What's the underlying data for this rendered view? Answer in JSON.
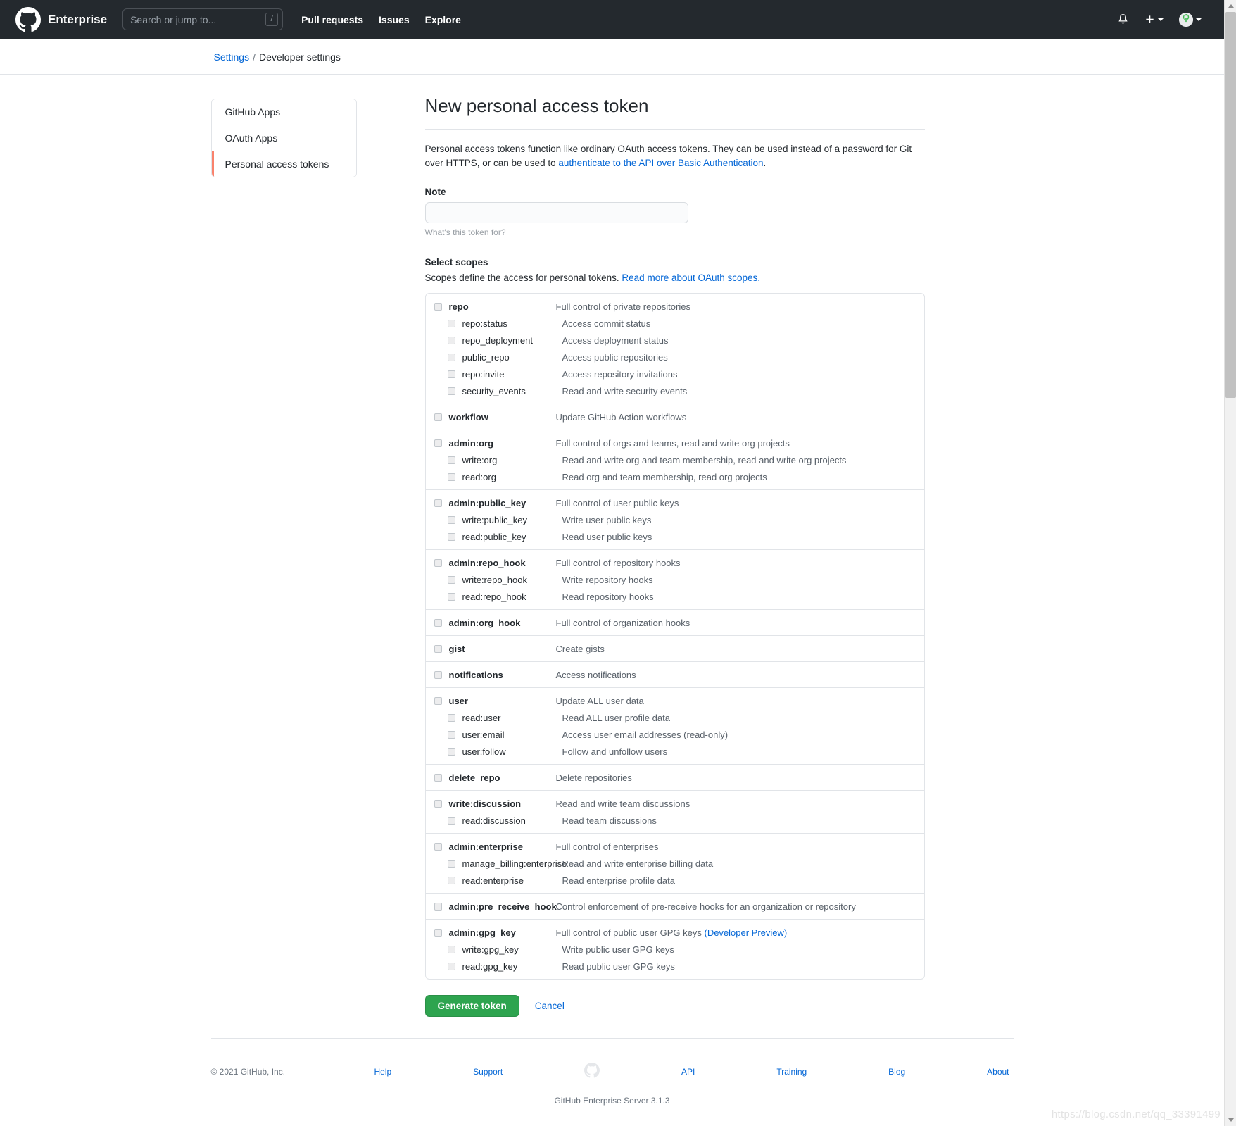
{
  "header": {
    "brand": "Enterprise",
    "search_placeholder": "Search or jump to...",
    "search_value": "",
    "slash_key": "/",
    "nav": [
      {
        "label": "Pull requests"
      },
      {
        "label": "Issues"
      },
      {
        "label": "Explore"
      }
    ],
    "icons": {
      "bell": "bell-icon",
      "plus": "plus-icon",
      "avatar": "avatar"
    }
  },
  "breadcrumb": {
    "root": "Settings",
    "separator": "/",
    "current": "Developer settings"
  },
  "sidebar": {
    "items": [
      {
        "label": "GitHub Apps",
        "active": false
      },
      {
        "label": "OAuth Apps",
        "active": false
      },
      {
        "label": "Personal access tokens",
        "active": true
      }
    ],
    "active_accent": "#f9826c"
  },
  "main": {
    "title": "New personal access token",
    "intro_part1": "Personal access tokens function like ordinary OAuth access tokens. They can be used instead of a password for Git over HTTPS, or can be used to ",
    "intro_link": "authenticate to the API over Basic Authentication",
    "intro_part2": ".",
    "note_label": "Note",
    "note_value": "",
    "note_placeholder": "",
    "note_hint": "What's this token for?",
    "scopes_label": "Select scopes",
    "scopes_sub_part1": "Scopes define the access for personal tokens. ",
    "scopes_sub_link": "Read more about OAuth scopes.",
    "generate_label": "Generate token",
    "cancel_label": "Cancel",
    "primary_color": "#2ea44f"
  },
  "scopes": [
    {
      "name": "repo",
      "desc": "Full control of private repositories",
      "checked": false,
      "children": [
        {
          "name": "repo:status",
          "desc": "Access commit status",
          "checked": false
        },
        {
          "name": "repo_deployment",
          "desc": "Access deployment status",
          "checked": false
        },
        {
          "name": "public_repo",
          "desc": "Access public repositories",
          "checked": false
        },
        {
          "name": "repo:invite",
          "desc": "Access repository invitations",
          "checked": false
        },
        {
          "name": "security_events",
          "desc": "Read and write security events",
          "checked": false
        }
      ]
    },
    {
      "name": "workflow",
      "desc": "Update GitHub Action workflows",
      "checked": false,
      "children": []
    },
    {
      "name": "admin:org",
      "desc": "Full control of orgs and teams, read and write org projects",
      "checked": false,
      "children": [
        {
          "name": "write:org",
          "desc": "Read and write org and team membership, read and write org projects",
          "checked": false
        },
        {
          "name": "read:org",
          "desc": "Read org and team membership, read org projects",
          "checked": false
        }
      ]
    },
    {
      "name": "admin:public_key",
      "desc": "Full control of user public keys",
      "checked": false,
      "children": [
        {
          "name": "write:public_key",
          "desc": "Write user public keys",
          "checked": false
        },
        {
          "name": "read:public_key",
          "desc": "Read user public keys",
          "checked": false
        }
      ]
    },
    {
      "name": "admin:repo_hook",
      "desc": "Full control of repository hooks",
      "checked": false,
      "children": [
        {
          "name": "write:repo_hook",
          "desc": "Write repository hooks",
          "checked": false
        },
        {
          "name": "read:repo_hook",
          "desc": "Read repository hooks",
          "checked": false
        }
      ]
    },
    {
      "name": "admin:org_hook",
      "desc": "Full control of organization hooks",
      "checked": false,
      "children": []
    },
    {
      "name": "gist",
      "desc": "Create gists",
      "checked": false,
      "children": []
    },
    {
      "name": "notifications",
      "desc": "Access notifications",
      "checked": false,
      "children": []
    },
    {
      "name": "user",
      "desc": "Update ALL user data",
      "checked": false,
      "children": [
        {
          "name": "read:user",
          "desc": "Read ALL user profile data",
          "checked": false
        },
        {
          "name": "user:email",
          "desc": "Access user email addresses (read-only)",
          "checked": false
        },
        {
          "name": "user:follow",
          "desc": "Follow and unfollow users",
          "checked": false
        }
      ]
    },
    {
      "name": "delete_repo",
      "desc": "Delete repositories",
      "checked": false,
      "children": []
    },
    {
      "name": "write:discussion",
      "desc": "Read and write team discussions",
      "checked": false,
      "children": [
        {
          "name": "read:discussion",
          "desc": "Read team discussions",
          "checked": false
        }
      ]
    },
    {
      "name": "admin:enterprise",
      "desc": "Full control of enterprises",
      "checked": false,
      "children": [
        {
          "name": "manage_billing:enterprise",
          "desc": "Read and write enterprise billing data",
          "checked": false
        },
        {
          "name": "read:enterprise",
          "desc": "Read enterprise profile data",
          "checked": false
        }
      ]
    },
    {
      "name": "admin:pre_receive_hook",
      "desc": "Control enforcement of pre-receive hooks for an organization or repository",
      "checked": false,
      "children": []
    },
    {
      "name": "admin:gpg_key",
      "desc": "Full control of public user GPG keys ",
      "desc_note": "(Developer Preview)",
      "checked": false,
      "children": [
        {
          "name": "write:gpg_key",
          "desc": "Write public user GPG keys",
          "checked": false
        },
        {
          "name": "read:gpg_key",
          "desc": "Read public user GPG keys",
          "checked": false
        }
      ]
    }
  ],
  "footer": {
    "copyright": "© 2021 GitHub, Inc.",
    "links": [
      {
        "label": "Help"
      },
      {
        "label": "Support"
      },
      {
        "label": "API"
      },
      {
        "label": "Training"
      },
      {
        "label": "Blog"
      },
      {
        "label": "About"
      }
    ],
    "version": "GitHub Enterprise Server 3.1.3"
  },
  "watermark": "https://blog.csdn.net/qq_33391499"
}
